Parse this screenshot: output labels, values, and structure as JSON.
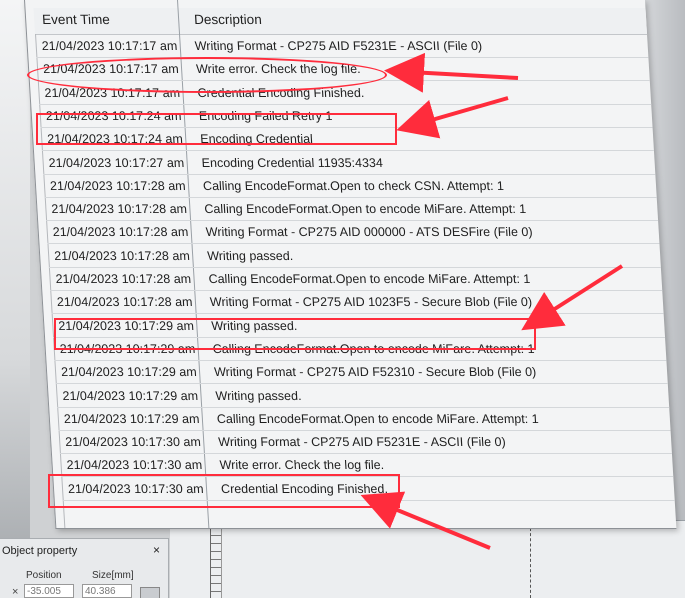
{
  "log": {
    "columns": {
      "time": "Event Time",
      "description": "Description"
    },
    "rows": [
      {
        "time": "21/04/2023 10:17:17 am",
        "description": "Writing Format - CP275 AID F5231E - ASCII (File 0)"
      },
      {
        "time": "21/04/2023 10:17:17 am",
        "description": "Write error. Check the log file."
      },
      {
        "time": "21/04/2023 10:17:17 am",
        "description": "Credential Encoding Finished."
      },
      {
        "time": "21/04/2023 10:17:24 am",
        "description": "Encoding Failed Retry 1"
      },
      {
        "time": "21/04/2023 10:17:24 am",
        "description": "Encoding Credential"
      },
      {
        "time": "21/04/2023 10:17:27 am",
        "description": "Encoding Credential 11935:4334"
      },
      {
        "time": "21/04/2023 10:17:28 am",
        "description": "Calling EncodeFormat.Open to check CSN.  Attempt: 1"
      },
      {
        "time": "21/04/2023 10:17:28 am",
        "description": "Calling EncodeFormat.Open to encode MiFare.  Attempt: 1"
      },
      {
        "time": "21/04/2023 10:17:28 am",
        "description": "Writing Format - CP275 AID 000000 - ATS    DESFire (File 0)"
      },
      {
        "time": "21/04/2023 10:17:28 am",
        "description": "Writing passed."
      },
      {
        "time": "21/04/2023 10:17:28 am",
        "description": "Calling EncodeFormat.Open to encode MiFare.  Attempt: 1"
      },
      {
        "time": "21/04/2023 10:17:28 am",
        "description": "Writing Format - CP275 AID 1023F5 - Secure Blob (File 0)"
      },
      {
        "time": "21/04/2023 10:17:29 am",
        "description": "Writing passed."
      },
      {
        "time": "21/04/2023 10:17:29 am",
        "description": "Calling EncodeFormat.Open to encode MiFare.  Attempt: 1"
      },
      {
        "time": "21/04/2023 10:17:29 am",
        "description": "Writing Format - CP275 AID F52310 - Secure Blob (File 0)"
      },
      {
        "time": "21/04/2023 10:17:29 am",
        "description": "Writing passed."
      },
      {
        "time": "21/04/2023 10:17:29 am",
        "description": "Calling EncodeFormat.Open to encode MiFare.  Attempt: 1"
      },
      {
        "time": "21/04/2023 10:17:30 am",
        "description": "Writing Format - CP275 AID F5231E - ASCII (File 0)"
      },
      {
        "time": "21/04/2023 10:17:30 am",
        "description": "Write error. Check the log file."
      },
      {
        "time": "21/04/2023 10:17:30 am",
        "description": "Credential Encoding Finished."
      }
    ]
  },
  "object_panel": {
    "title": "Object property",
    "close": "×",
    "position_label": "Position",
    "size_label": "Size[mm]",
    "position_value": "-35.005",
    "size_value": "40.386",
    "row_marker": "×"
  },
  "annotation_color": "#ff2c3c"
}
